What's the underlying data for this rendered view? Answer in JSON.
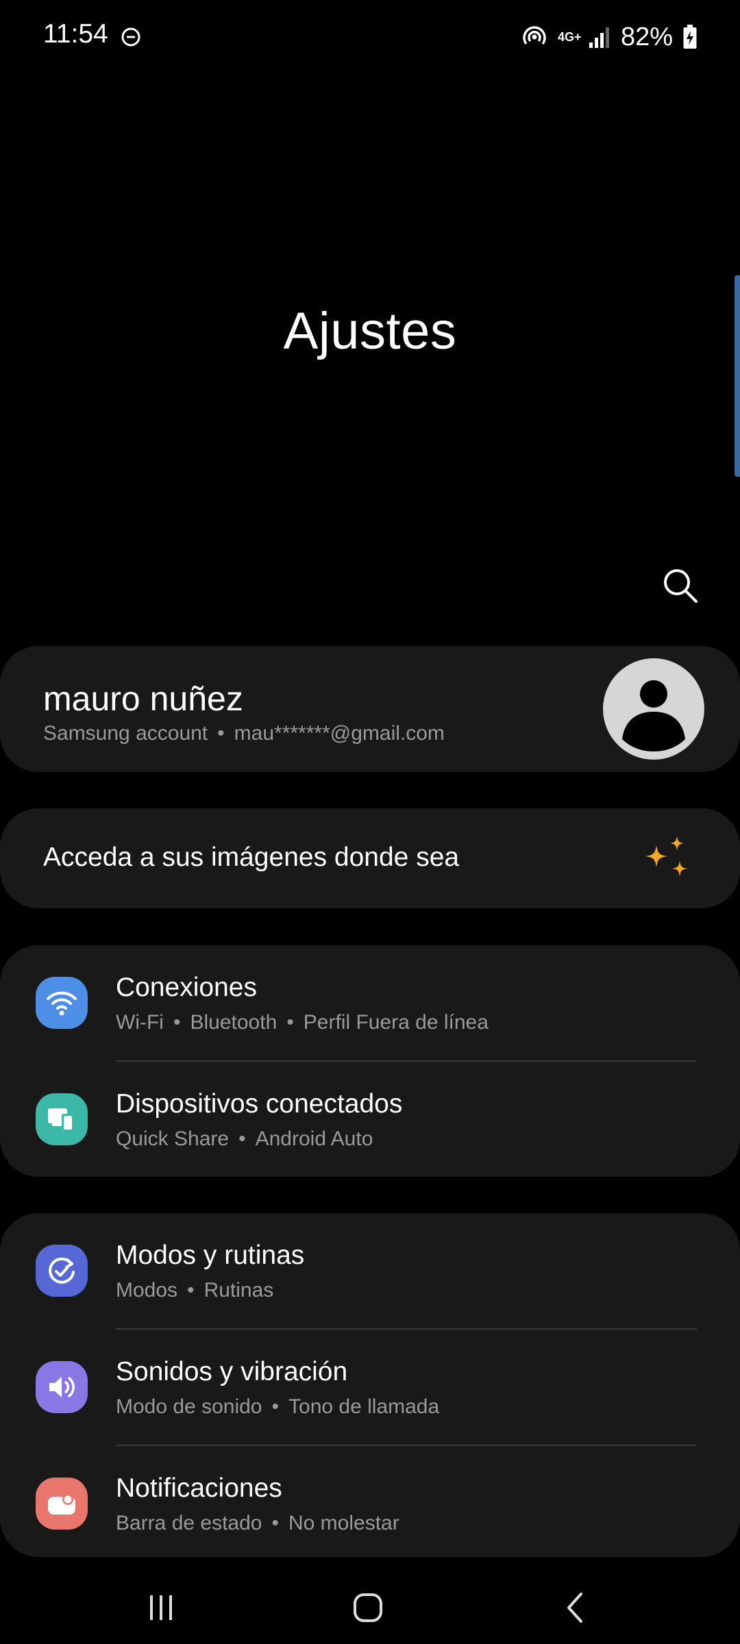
{
  "status_bar": {
    "time": "11:54",
    "network": "4G+",
    "battery": "82%"
  },
  "page": {
    "title": "Ajustes"
  },
  "account": {
    "name": "mauro nuñez",
    "label": "Samsung account",
    "email": "mau*******@gmail.com"
  },
  "promo": {
    "text": "Acceda a sus imágenes donde sea"
  },
  "groups": [
    {
      "items": [
        {
          "title": "Conexiones",
          "subs": [
            "Wi-Fi",
            "Bluetooth",
            "Perfil Fuera de línea"
          ],
          "icon": "wifi-icon",
          "color": "#4d8fe6"
        },
        {
          "title": "Dispositivos conectados",
          "subs": [
            "Quick Share",
            "Android Auto"
          ],
          "icon": "connected-devices-icon",
          "color": "#3bb8a8"
        }
      ]
    },
    {
      "items": [
        {
          "title": "Modos y rutinas",
          "subs": [
            "Modos",
            "Rutinas"
          ],
          "icon": "modes-routines-icon",
          "color": "#5568d6"
        },
        {
          "title": "Sonidos y vibración",
          "subs": [
            "Modo de sonido",
            "Tono de llamada"
          ],
          "icon": "sound-icon",
          "color": "#8a77e6"
        },
        {
          "title": "Notificaciones",
          "subs": [
            "Barra de estado",
            "No molestar"
          ],
          "icon": "notifications-icon",
          "color": "#e8766c"
        }
      ]
    }
  ],
  "colors": {
    "background": "#000000",
    "card": "#191919",
    "secondary_text": "#9a9a9a",
    "accent_sparkle": "#f5a623"
  }
}
